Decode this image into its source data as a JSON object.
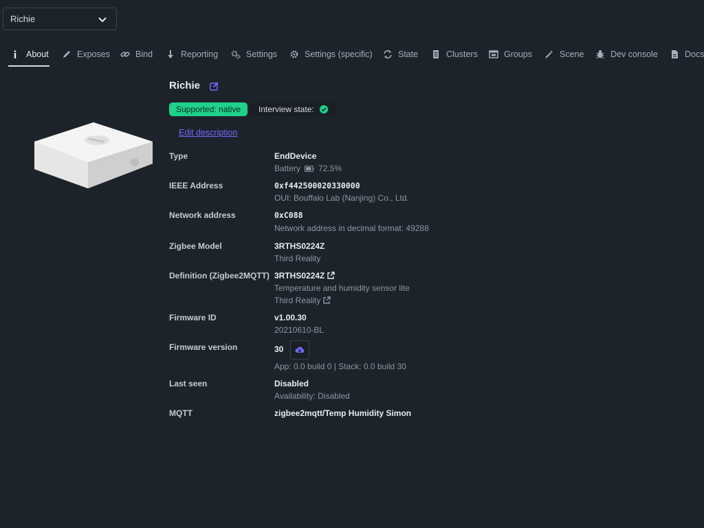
{
  "device_select": {
    "value": "Richie"
  },
  "tabs": [
    {
      "label": "About",
      "icon": "info-icon"
    },
    {
      "label": "Exposes",
      "icon": "pen-icon"
    },
    {
      "label": "Bind",
      "icon": "link-icon"
    },
    {
      "label": "Reporting",
      "icon": "arrow-down-icon"
    },
    {
      "label": "Settings",
      "icon": "cogs-icon"
    },
    {
      "label": "Settings (specific)",
      "icon": "cog-icon"
    },
    {
      "label": "State",
      "icon": "sync-icon"
    },
    {
      "label": "Clusters",
      "icon": "file-icon"
    },
    {
      "label": "Groups",
      "icon": "window-icon"
    },
    {
      "label": "Scene",
      "icon": "magic-wand-icon"
    },
    {
      "label": "Dev console",
      "icon": "bug-icon"
    },
    {
      "label": "Docs",
      "icon": "doc-icon"
    }
  ],
  "device": {
    "title": "Richie",
    "supported": "Supported: native",
    "interview_label": "Interview state:",
    "edit_description": "Edit description"
  },
  "details": {
    "type": {
      "label": "Type",
      "value": "EndDevice",
      "sub_prefix": "Battery",
      "sub_value": "72.5%"
    },
    "ieee": {
      "label": "IEEE Address",
      "value": "0xf442500020330000",
      "sub": "OUI: Bouffalo Lab (Nanjing) Co., Ltd."
    },
    "network": {
      "label": "Network address",
      "value": "0xC088",
      "sub": "Network address in decimal format: 49288"
    },
    "model": {
      "label": "Zigbee Model",
      "value": "3RTHS0224Z",
      "sub": "Third Reality"
    },
    "definition": {
      "label": "Definition (Zigbee2MQTT)",
      "value": "3RTHS0224Z",
      "sub": "Temperature and humidity sensor lite",
      "vendor": "Third Reality"
    },
    "firmware_id": {
      "label": "Firmware ID",
      "value": "v1.00.30",
      "sub": "20210610-BL"
    },
    "firmware_version": {
      "label": "Firmware version",
      "value": "30",
      "sub": "App: 0.0 build 0 | Stack: 0.0 build 30"
    },
    "last_seen": {
      "label": "Last seen",
      "value": "Disabled",
      "sub": "Availability: Disabled"
    },
    "mqtt": {
      "label": "MQTT",
      "value": "zigbee2mqtt/Temp Humidity Simon"
    }
  },
  "colors": {
    "background": "#1d232a",
    "accent": "#6f6bff",
    "success": "#1fd18a"
  }
}
